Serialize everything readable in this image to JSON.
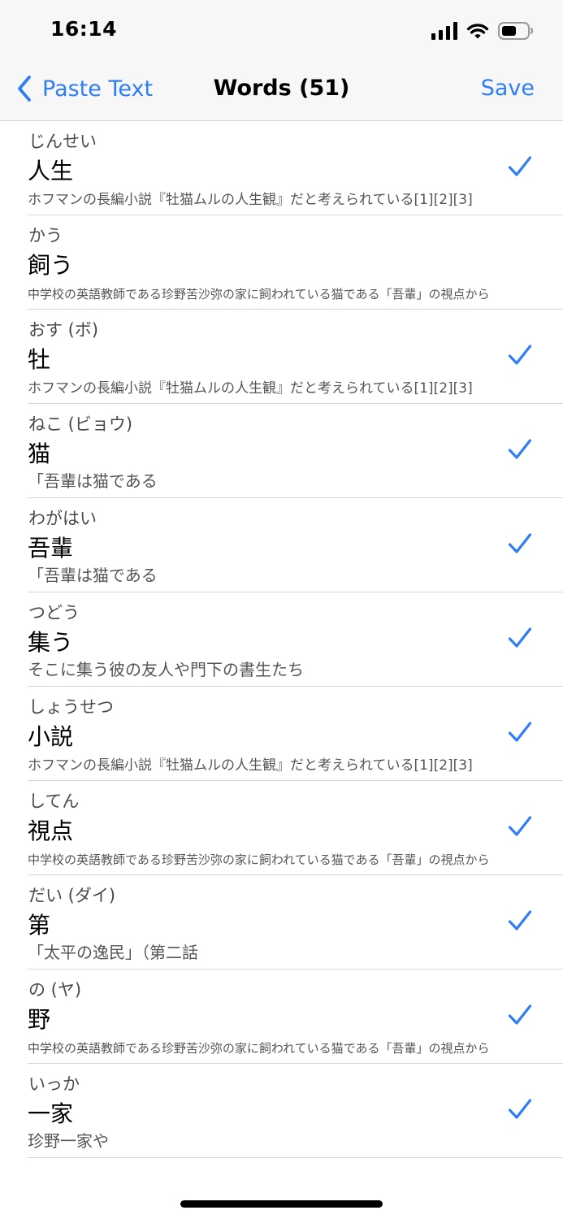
{
  "status_bar": {
    "time": "16:14",
    "icons": [
      "cellular-signal-icon",
      "wifi-icon",
      "battery-icon"
    ]
  },
  "nav": {
    "back_label": "Paste Text",
    "title": "Words (51)",
    "save_label": "Save"
  },
  "colors": {
    "accent": "#2f7ef6",
    "separator": "#d6d6d6"
  },
  "words": [
    {
      "reading": "じんせい",
      "word": "人生",
      "context": "ホフマンの長編小説『牡猫ムルの人生観』だと考えられている[1][2][3]",
      "checked": true
    },
    {
      "reading": "かう",
      "word": "飼う",
      "context": "中学校の英語教師である珍野苦沙弥の家に飼われている猫である「吾輩」の視点から",
      "checked": false
    },
    {
      "reading": "おす (ボ)",
      "word": "牡",
      "context": "ホフマンの長編小説『牡猫ムルの人生観』だと考えられている[1][2][3]",
      "checked": true
    },
    {
      "reading": "ねこ (ビョウ)",
      "word": "猫",
      "context": "「吾輩は猫である",
      "checked": true
    },
    {
      "reading": "わがはい",
      "word": "吾輩",
      "context": "「吾輩は猫である",
      "checked": true
    },
    {
      "reading": "つどう",
      "word": "集う",
      "context": "そこに集う彼の友人や門下の書生たち",
      "checked": true
    },
    {
      "reading": "しょうせつ",
      "word": "小説",
      "context": "ホフマンの長編小説『牡猫ムルの人生観』だと考えられている[1][2][3]",
      "checked": true
    },
    {
      "reading": "してん",
      "word": "視点",
      "context": "中学校の英語教師である珍野苦沙弥の家に飼われている猫である「吾輩」の視点から",
      "checked": true
    },
    {
      "reading": "だい (ダイ)",
      "word": "第",
      "context": "「太平の逸民」（第二話",
      "checked": true
    },
    {
      "reading": "の (ヤ)",
      "word": "野",
      "context": "中学校の英語教師である珍野苦沙弥の家に飼われている猫である「吾輩」の視点から",
      "checked": true
    },
    {
      "reading": "いっか",
      "word": "一家",
      "context": "珍野一家や",
      "checked": true
    }
  ]
}
